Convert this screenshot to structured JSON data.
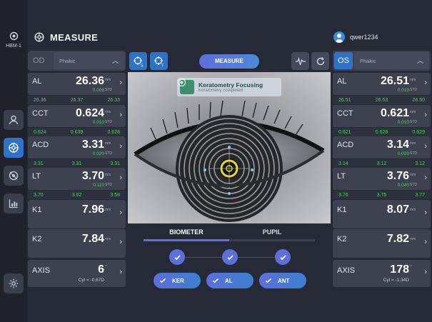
{
  "app": {
    "device_label": "HBM-1",
    "title": "MEASURE",
    "user": "qwer1234"
  },
  "nav": [
    "patient-icon",
    "measure-icon",
    "eye-icon",
    "chart-icon",
    "settings-icon"
  ],
  "left": {
    "eye": "OD",
    "lens": "Phakic",
    "rows": {
      "al": {
        "name": "AL",
        "value": "26.36",
        "unit": "mm",
        "std": "0.008",
        "std_label": "STD",
        "subs": [
          "26.36",
          "26.37",
          "26.33"
        ]
      },
      "cct": {
        "name": "CCT",
        "value": "0.624",
        "unit": "mm",
        "std": "0.010",
        "std_label": "STD",
        "subs": [
          "0.624",
          "0.639",
          "0.628"
        ]
      },
      "acd": {
        "name": "ACD",
        "value": "3.31",
        "unit": "mm",
        "std": "0.020",
        "std_label": "STD",
        "subs": [
          "3.31",
          "3.31",
          "3.31"
        ]
      },
      "lt": {
        "name": "LT",
        "value": "3.70",
        "unit": "mm",
        "std": "0.110",
        "std_label": "STD",
        "subs": [
          "3.70",
          "3.62",
          "3.58"
        ]
      },
      "k1": {
        "name": "K1",
        "value": "7.96",
        "unit": "mm"
      },
      "k2": {
        "name": "K2",
        "value": "7.84",
        "unit": "mm"
      },
      "axis": {
        "name": "AXIS",
        "value": "6",
        "unit": "°",
        "cyl": "Cyl = -0.67D"
      }
    }
  },
  "right": {
    "eye": "OS",
    "lens": "Phakic",
    "rows": {
      "al": {
        "name": "AL",
        "value": "26.51",
        "unit": "mm",
        "std": "0.019",
        "std_label": "STD",
        "subs": [
          "26.51",
          "26.53",
          "26.50"
        ]
      },
      "cct": {
        "name": "CCT",
        "value": "0.621",
        "unit": "mm",
        "std": "0.010",
        "std_label": "STD",
        "subs": [
          "0.621",
          "0.628",
          "0.629"
        ]
      },
      "acd": {
        "name": "ACD",
        "value": "3.14",
        "unit": "mm",
        "std": "0.020",
        "std_label": "STD",
        "subs": [
          "3.14",
          "3.12",
          "3.12"
        ]
      },
      "lt": {
        "name": "LT",
        "value": "3.76",
        "unit": "mm",
        "std": "0.040",
        "std_label": "STD",
        "subs": [
          "3.76",
          "3.75",
          "3.77"
        ]
      },
      "k1": {
        "name": "K1",
        "value": "8.07",
        "unit": "mm"
      },
      "k2": {
        "name": "K2",
        "value": "7.82",
        "unit": "mm"
      },
      "axis": {
        "name": "AXIS",
        "value": "178",
        "unit": "°",
        "cyl": "Cyl = -1.34D"
      }
    }
  },
  "center": {
    "measure_label": "MEASURE",
    "tool_badges": {
      "s": "S",
      "t": "T"
    },
    "focus": {
      "title": "Keratometry Focusing",
      "subtitle": "Keratometry completed"
    },
    "tabs": [
      "BIOMETER",
      "PUPIL"
    ],
    "pills": [
      "KER",
      "AL",
      "ANT"
    ]
  },
  "colors": {
    "accent": "#2f72c8",
    "gradient": "#5d6fd9",
    "std_green": "#4fce67"
  }
}
